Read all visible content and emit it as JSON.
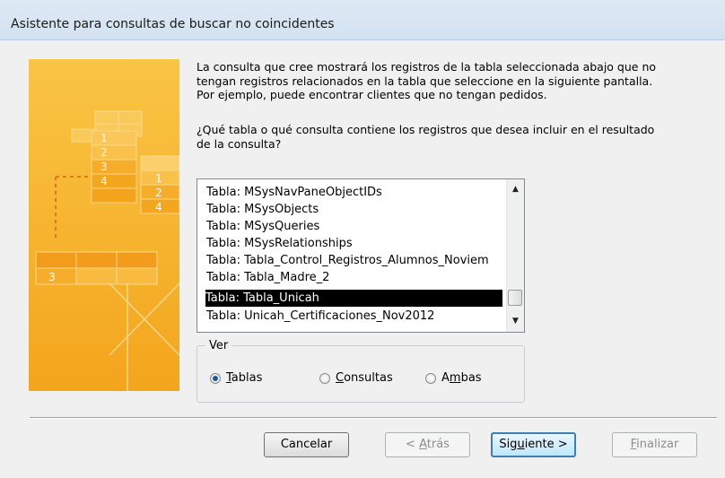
{
  "window": {
    "title": "Asistente para consultas de buscar no coincidentes"
  },
  "intro": {
    "line1": "La consulta que cree mostrará los registros de la tabla seleccionada abajo que no",
    "line2": "tengan registros relacionados en la tabla que seleccione en la siguiente pantalla.",
    "line3": "Por ejemplo, puede encontrar clientes que no tengan pedidos."
  },
  "question": {
    "line1": "¿Qué tabla o qué consulta contiene los registros que desea incluir en el resultado",
    "line2": "de la consulta?"
  },
  "list": {
    "items": [
      "Tabla: MSysNavPaneObjectIDs",
      "Tabla: MSysObjects",
      "Tabla: MSysQueries",
      "Tabla: MSysRelationships",
      "Tabla: Tabla_Control_Registros_Alumnos_Noviem",
      "Tabla: Tabla_Madre_2",
      "Tabla: Tabla_Unicah",
      "Tabla: Unicah_Certificaciones_Nov2012"
    ],
    "selected_index": 6
  },
  "view_group": {
    "legend": "Ver",
    "options": [
      {
        "first": "T",
        "rest": "ablas",
        "checked": true
      },
      {
        "first": "C",
        "rest": "onsultas",
        "checked": false
      },
      {
        "pre": "A",
        "u": "m",
        "rest": "bas",
        "checked": false
      }
    ]
  },
  "illustration": {
    "labels": [
      "1",
      "2",
      "3",
      "4",
      "1",
      "2",
      "4",
      "3"
    ]
  },
  "buttons": {
    "cancel": "Cancelar",
    "back_prefix": "< ",
    "back_u": "A",
    "back_rest": "trás",
    "next_pre": "Sig",
    "next_u": "u",
    "next_rest": "iente >",
    "finish_u": "F",
    "finish_rest": "inalizar"
  },
  "colors": {
    "illustration_orange": "#f7b52a",
    "selection": "#000000"
  }
}
